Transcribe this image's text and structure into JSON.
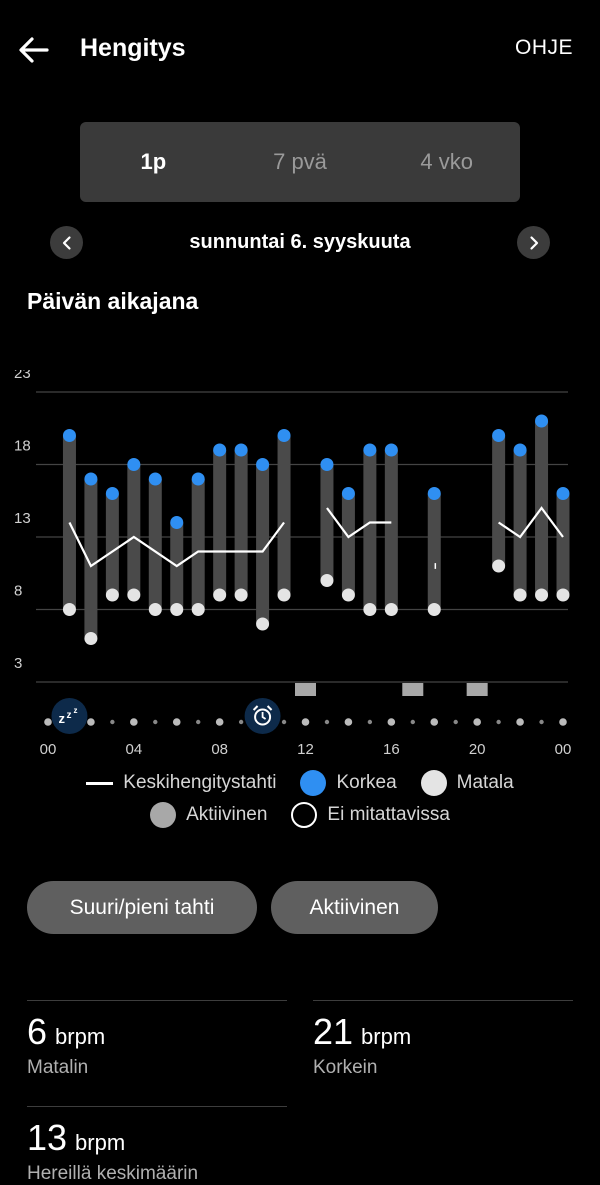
{
  "header": {
    "title": "Hengitys",
    "help_label": "OHJE",
    "back_icon": "arrow-left-icon"
  },
  "period_tabs": [
    {
      "label": "1p",
      "selected": true
    },
    {
      "label": "7 pvä",
      "selected": false
    },
    {
      "label": "4 vko",
      "selected": false
    }
  ],
  "date": {
    "label": "sunnuntai 6. syyskuuta",
    "prev_icon": "chevron-left-icon",
    "next_icon": "chevron-right-icon"
  },
  "section_title": "Päivän aikajana",
  "chart_data": {
    "type": "range_bar_line",
    "ylim": [
      3,
      23
    ],
    "y_ticks": [
      "23",
      "18",
      "13",
      "8",
      "3"
    ],
    "y_tick_values": [
      23,
      18,
      13,
      8,
      3
    ],
    "x_tick_labels": [
      "00",
      "04",
      "08",
      "12",
      "16",
      "20",
      "00"
    ],
    "x_tick_hours": [
      0,
      4,
      8,
      12,
      16,
      20,
      24
    ],
    "bars": [
      {
        "hour": 1,
        "low": 8,
        "high": 20
      },
      {
        "hour": 2,
        "low": 6,
        "high": 17
      },
      {
        "hour": 3,
        "low": 9,
        "high": 16
      },
      {
        "hour": 4,
        "low": 9,
        "high": 18
      },
      {
        "hour": 5,
        "low": 8,
        "high": 17
      },
      {
        "hour": 6,
        "low": 8,
        "high": 14
      },
      {
        "hour": 7,
        "low": 8,
        "high": 17
      },
      {
        "hour": 8,
        "low": 9,
        "high": 19
      },
      {
        "hour": 9,
        "low": 9,
        "high": 19
      },
      {
        "hour": 10,
        "low": 7,
        "high": 18
      },
      {
        "hour": 11,
        "low": 9,
        "high": 20
      },
      {
        "hour": 13,
        "low": 10,
        "high": 18
      },
      {
        "hour": 14,
        "low": 9,
        "high": 16
      },
      {
        "hour": 15,
        "low": 8,
        "high": 19
      },
      {
        "hour": 16,
        "low": 8,
        "high": 19
      },
      {
        "hour": 18,
        "low": 8,
        "high": 16
      },
      {
        "hour": 21,
        "low": 11,
        "high": 20
      },
      {
        "hour": 22,
        "low": 9,
        "high": 19
      },
      {
        "hour": 23,
        "low": 9,
        "high": 21
      },
      {
        "hour": 24,
        "low": 9,
        "high": 16
      }
    ],
    "average_segments": [
      {
        "hours": [
          1,
          2,
          4,
          6,
          7,
          10,
          11
        ],
        "values": [
          14,
          11,
          13,
          11,
          12,
          12,
          14
        ]
      },
      {
        "hours": [
          13,
          14,
          15,
          16
        ],
        "values": [
          15,
          13,
          14,
          14
        ]
      },
      {
        "hours": [
          21,
          22,
          23,
          24
        ],
        "values": [
          14,
          13,
          15,
          13
        ]
      }
    ],
    "active_hours": [
      12,
      17,
      20
    ],
    "sleep_icon_hour": 1,
    "alarm_icon_hour": 10,
    "colors": {
      "bar": "#4a4a4a",
      "high": "#2f8ff2",
      "low": "#e4e4e4",
      "average": "#ffffff",
      "active": "#a8a8a8",
      "grid": "#444444"
    }
  },
  "legend": [
    {
      "label": "Keskihengitystahti",
      "kind": "line",
      "color": "#ffffff"
    },
    {
      "label": "Korkea",
      "kind": "dot",
      "color": "#2f8ff2"
    },
    {
      "label": "Matala",
      "kind": "dot",
      "color": "#e4e4e4"
    },
    {
      "label": "Aktiivinen",
      "kind": "dot",
      "color": "#a8a8a8"
    },
    {
      "label": "Ei mitattavissa",
      "kind": "ring",
      "color": "#ffffff"
    }
  ],
  "filters": [
    {
      "label": "Suuri/pieni tahti"
    },
    {
      "label": "Aktiivinen"
    }
  ],
  "stats": [
    {
      "value": "6",
      "unit": "brpm",
      "label": "Matalin"
    },
    {
      "value": "21",
      "unit": "brpm",
      "label": "Korkein"
    },
    {
      "value": "13",
      "unit": "brpm",
      "label": "Hereillä keskimäärin"
    }
  ]
}
